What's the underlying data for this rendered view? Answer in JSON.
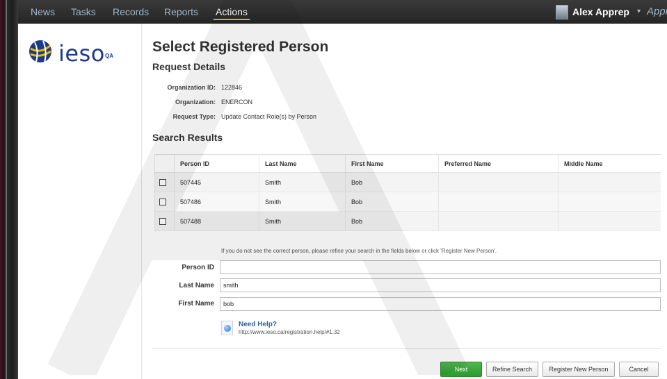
{
  "nav": {
    "items": [
      {
        "label": "News"
      },
      {
        "label": "Tasks"
      },
      {
        "label": "Records"
      },
      {
        "label": "Reports"
      },
      {
        "label": "Actions",
        "active": true
      }
    ],
    "user_name": "Alex Apprep",
    "user_caret": "▾",
    "app_name": "Appian"
  },
  "logo": {
    "text": "ieso",
    "badge": "QA",
    "icon": "ieso-globe-icon",
    "brand_color": "#1b3a8a"
  },
  "page": {
    "title": "Select Registered Person",
    "request_details_heading": "Request Details",
    "details": [
      {
        "label": "Organization ID:",
        "value": "122846"
      },
      {
        "label": "Organization:",
        "value": "ENERCON"
      },
      {
        "label": "Request Type:",
        "value": "Update Contact Role(s) by Person"
      }
    ],
    "search_results_heading": "Search Results"
  },
  "table": {
    "headers": [
      "Person ID",
      "Last Name",
      "First Name",
      "Preferred Name",
      "Middle Name"
    ],
    "rows": [
      {
        "person_id": "507445",
        "last_name": "Smith",
        "first_name": "Bob",
        "preferred_name": "",
        "middle_name": "",
        "checked": false
      },
      {
        "person_id": "507486",
        "last_name": "Smith",
        "first_name": "Bob",
        "preferred_name": "",
        "middle_name": "",
        "checked": false
      },
      {
        "person_id": "507488",
        "last_name": "Smith",
        "first_name": "Bob",
        "preferred_name": "",
        "middle_name": "",
        "checked": false
      }
    ]
  },
  "search_form": {
    "hint": "If you do not see the correct person, please refine your search in the fields below or click 'Register New Person'.",
    "fields": [
      {
        "label": "Person ID",
        "value": ""
      },
      {
        "label": "Last Name",
        "value": "smith"
      },
      {
        "label": "First Name",
        "value": "bob"
      }
    ]
  },
  "help": {
    "title": "Need Help?",
    "url": "http://www.ieso.ca/registration.help/#1.32",
    "icon": "globe-help-icon"
  },
  "buttons": {
    "next": "Next",
    "refine": "Refine Search",
    "register": "Register New Person",
    "cancel": "Cancel"
  },
  "colors": {
    "nav_bg": "#2a2a2a",
    "nav_link": "#9db6c9",
    "nav_active_underline": "#e4c400",
    "primary_button": "#3aa83a"
  }
}
